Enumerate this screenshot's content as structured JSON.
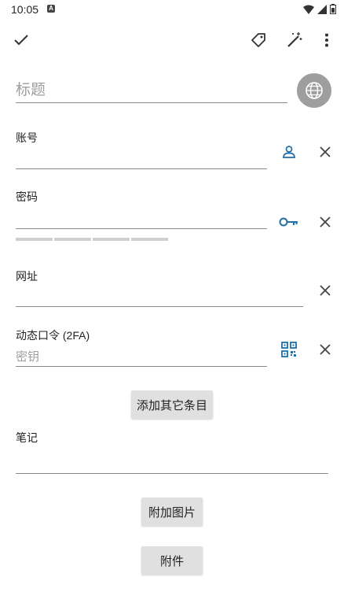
{
  "status_bar": {
    "time": "10:05",
    "notification_letter": "A"
  },
  "toolbar": {
    "icons": [
      "checkmark-icon",
      "tag-icon",
      "magic-wand-icon",
      "more-vert-icon"
    ]
  },
  "title": {
    "placeholder": "标题"
  },
  "fields": {
    "account": {
      "label": "账号",
      "value": ""
    },
    "password": {
      "label": "密码",
      "value": "",
      "strength_segments": 4
    },
    "url": {
      "label": "网址",
      "value": ""
    },
    "otp": {
      "label": "动态口令 (2FA)",
      "placeholder": "密钥"
    }
  },
  "buttons": {
    "add_item": "添加其它条目",
    "attach_image": "附加图片",
    "attachment": "附件"
  },
  "notes": {
    "label": "笔记",
    "value": ""
  },
  "colors": {
    "accent": "#1f6fa8",
    "line": "#8a8a8a",
    "button_bg": "#e0e0e0",
    "globe_bg": "#9e9e9e"
  }
}
